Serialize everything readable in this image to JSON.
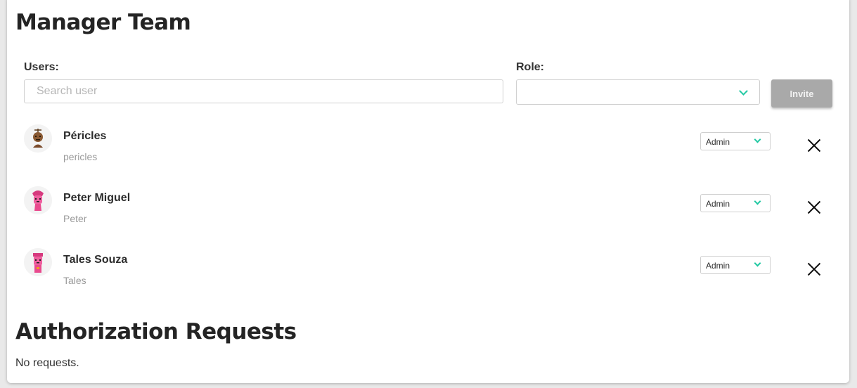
{
  "manager_team": {
    "title": "Manager Team",
    "users_label": "Users:",
    "search_placeholder": "Search user",
    "role_label": "Role:",
    "role_value": "",
    "invite_label": "Invite"
  },
  "members": [
    {
      "name": "Péricles",
      "username": "pericles",
      "role": "Admin",
      "avatar_color": "#7a4a2a"
    },
    {
      "name": "Peter Miguel",
      "username": "Peter",
      "role": "Admin",
      "avatar_color": "#e94a8e"
    },
    {
      "name": "Tales Souza",
      "username": "Tales",
      "role": "Admin",
      "avatar_color": "#e94a8e"
    }
  ],
  "authorization_requests": {
    "title": "Authorization Requests",
    "empty_text": "No requests."
  },
  "colors": {
    "accent": "#1fc8a2",
    "invite_button_disabled": "#a9a9a9"
  }
}
